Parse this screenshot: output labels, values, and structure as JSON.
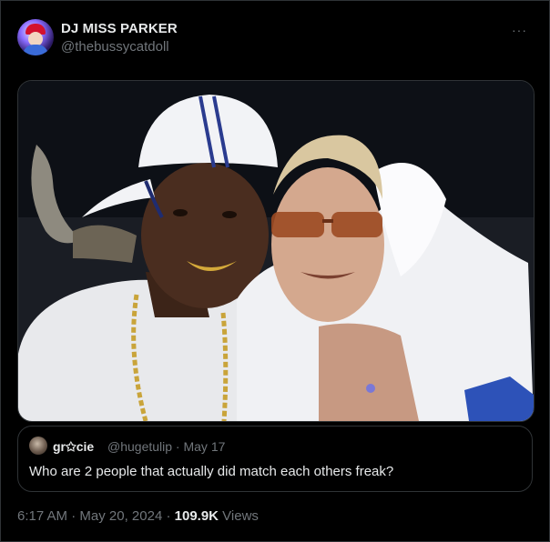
{
  "author": {
    "display_name": "DJ MISS PARKER",
    "handle": "@thebussycatdoll",
    "avatar_icon": "profile-avatar"
  },
  "menu": {
    "more_label": "···"
  },
  "media": {
    "icon": "photo"
  },
  "quoted": {
    "name": "gr✩cie",
    "meta": "@hugetulip · May 17",
    "text": "Who are 2 people that actually did match each others freak?"
  },
  "footer": {
    "time": "6:17 AM",
    "separator1": " · ",
    "date": "May 20, 2024",
    "separator2": " · ",
    "views_count": "109.9K",
    "views_label": " Views"
  },
  "colors": {
    "background": "#000000",
    "border": "#2f3336",
    "primary_text": "#e7e9ea",
    "secondary_text": "#71767b"
  }
}
